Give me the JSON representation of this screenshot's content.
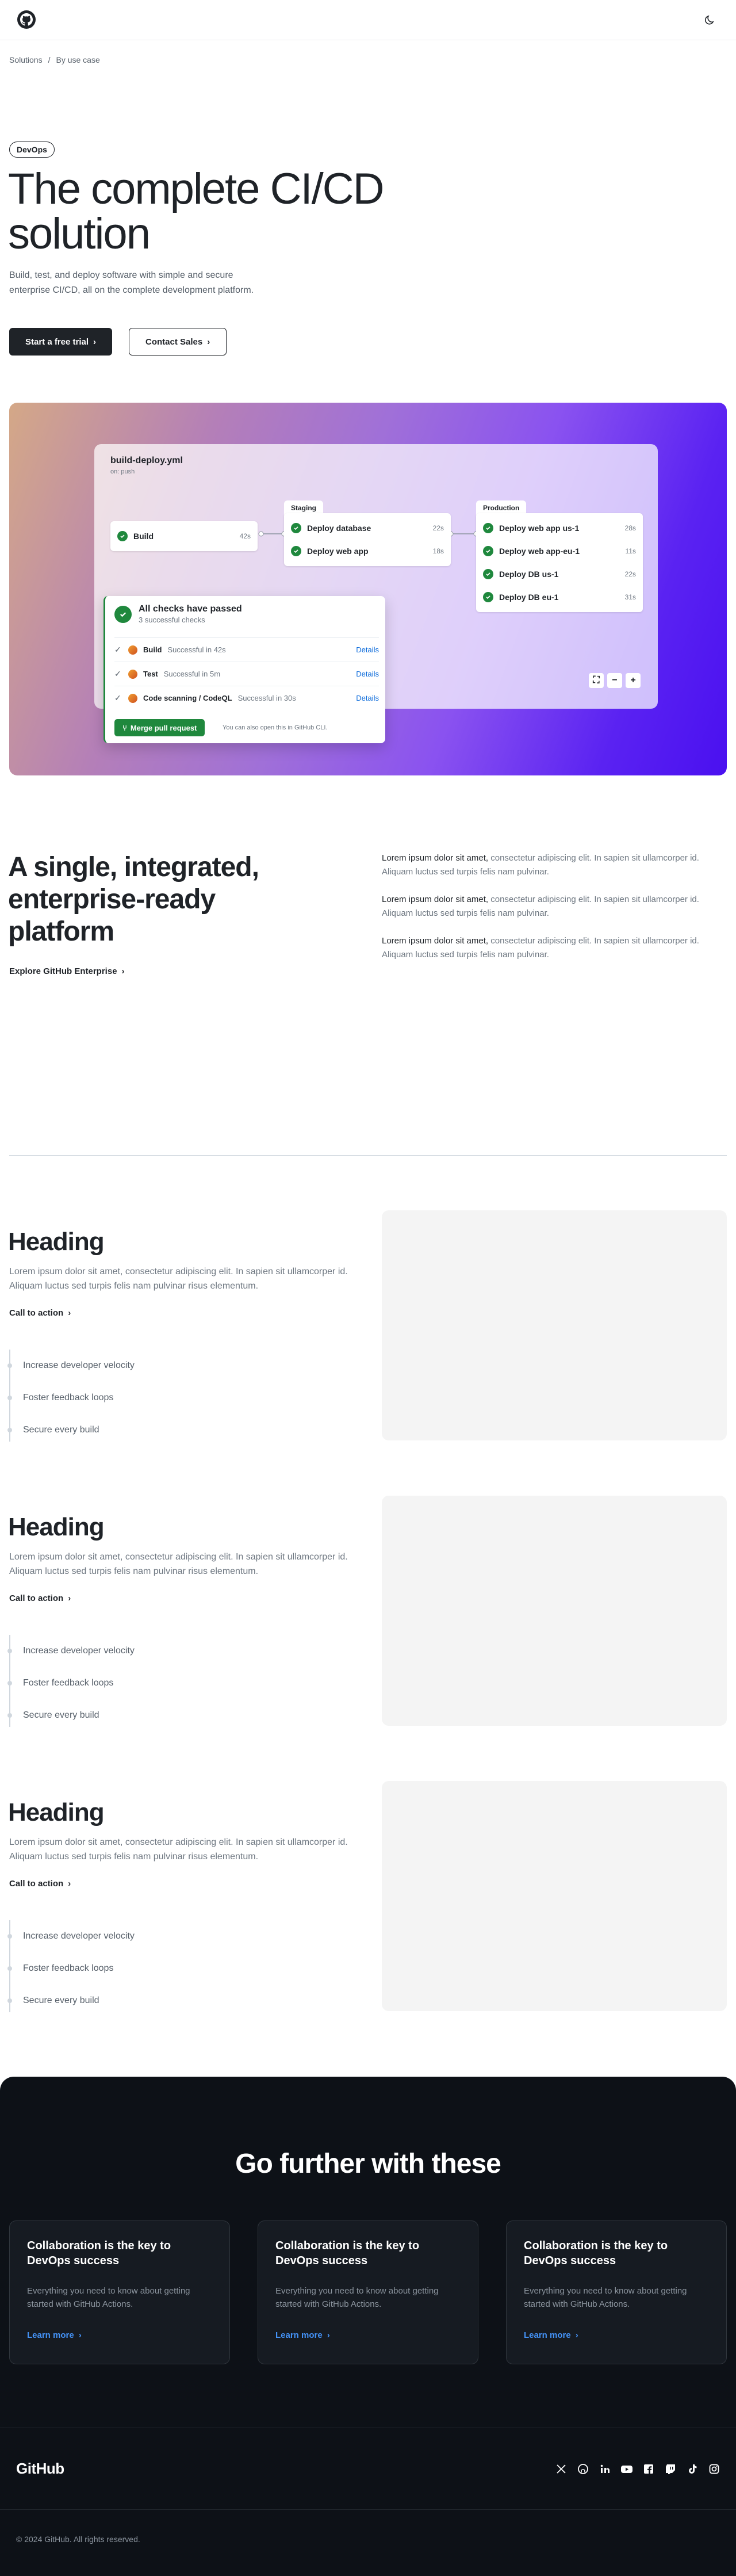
{
  "breadcrumb": {
    "items": [
      "Solutions",
      "By use case"
    ],
    "sep": "/"
  },
  "hero": {
    "badge": "DevOps",
    "title": "The complete CI/CD solution",
    "description": "Build, test, and deploy software with simple and secure enterprise CI/CD, all on the complete development platform.",
    "primary_cta": "Start a free trial",
    "secondary_cta": "Contact Sales"
  },
  "workflow": {
    "file": "build-deploy.yml",
    "trigger": "on: push",
    "build": {
      "name": "Build",
      "time": "42s"
    },
    "staging": {
      "label": "Staging",
      "jobs": [
        {
          "name": "Deploy database",
          "time": "22s"
        },
        {
          "name": "Deploy web app",
          "time": "18s"
        }
      ]
    },
    "production": {
      "label": "Production",
      "jobs": [
        {
          "name": "Deploy web app us-1",
          "time": "28s"
        },
        {
          "name": "Deploy web app-eu-1",
          "time": "11s"
        },
        {
          "name": "Deploy DB us-1",
          "time": "22s"
        },
        {
          "name": "Deploy DB eu-1",
          "time": "31s"
        }
      ]
    },
    "zoom": [
      "⛶",
      "−",
      "+"
    ]
  },
  "checks": {
    "title": "All checks have passed",
    "subtitle": "3 successful checks",
    "rows": [
      {
        "name": "Build",
        "status": "Successful in 42s",
        "link": "Details"
      },
      {
        "name": "Test",
        "status": "Successful in 5m",
        "link": "Details"
      },
      {
        "name": "Code scanning / CodeQL",
        "status": "Successful in 30s",
        "link": "Details"
      }
    ],
    "merge_button": "Merge pull request",
    "merge_note": "You can also open this in GitHub CLI."
  },
  "platform": {
    "title": "A single, integrated, enterprise-ready platform",
    "link": "Explore GitHub Enterprise",
    "paragraphs": [
      {
        "lead": "Lorem ipsum dolor sit amet,",
        "rest": " consectetur adipiscing elit. In sapien sit ullamcorper id. Aliquam luctus sed turpis felis nam pulvinar."
      },
      {
        "lead": "Lorem ipsum dolor sit amet,",
        "rest": " consectetur adipiscing elit. In sapien sit ullamcorper id. Aliquam luctus sed turpis felis nam pulvinar."
      },
      {
        "lead": "Lorem ipsum dolor sit amet,",
        "rest": " consectetur adipiscing elit. In sapien sit ullamcorper id. Aliquam luctus sed turpis felis nam pulvinar."
      }
    ]
  },
  "features": [
    {
      "heading": "Heading",
      "description": "Lorem ipsum dolor sit amet, consectetur adipiscing elit. In sapien sit ullamcorper id. Aliquam luctus sed turpis felis nam pulvinar risus elementum.",
      "cta": "Call to action",
      "items": [
        "Increase developer velocity",
        "Foster feedback loops",
        "Secure every build"
      ]
    },
    {
      "heading": "Heading",
      "description": "Lorem ipsum dolor sit amet, consectetur adipiscing elit. In sapien sit ullamcorper id. Aliquam luctus sed turpis felis nam pulvinar risus elementum.",
      "cta": "Call to action",
      "items": [
        "Increase developer velocity",
        "Foster feedback loops",
        "Secure every build"
      ]
    },
    {
      "heading": "Heading",
      "description": "Lorem ipsum dolor sit amet, consectetur adipiscing elit. In sapien sit ullamcorper id. Aliquam luctus sed turpis felis nam pulvinar risus elementum.",
      "cta": "Call to action",
      "items": [
        "Increase developer velocity",
        "Foster feedback loops",
        "Secure every build"
      ]
    }
  ],
  "further": {
    "title": "Go further with these",
    "cards": [
      {
        "title": "Collaboration is the key to DevOps success",
        "description": "Everything you need to know about getting started with GitHub Actions.",
        "link": "Learn more"
      },
      {
        "title": "Collaboration is the key to DevOps success",
        "description": "Everything you need to know about getting started with GitHub Actions.",
        "link": "Learn more"
      },
      {
        "title": "Collaboration is the key to DevOps success",
        "description": "Everything you need to know about getting started with GitHub Actions.",
        "link": "Learn more"
      }
    ]
  },
  "footer": {
    "logo": "GitHub",
    "socials": [
      "x-icon",
      "github-icon",
      "linkedin-icon",
      "youtube-icon",
      "facebook-icon",
      "twitch-icon",
      "tiktok-icon",
      "instagram-icon"
    ],
    "copyright": "© 2024 GitHub. All rights reserved."
  },
  "colors": {
    "accent_green": "#1f883d",
    "link_blue": "#0969da",
    "dark_bg": "#0d1117"
  }
}
